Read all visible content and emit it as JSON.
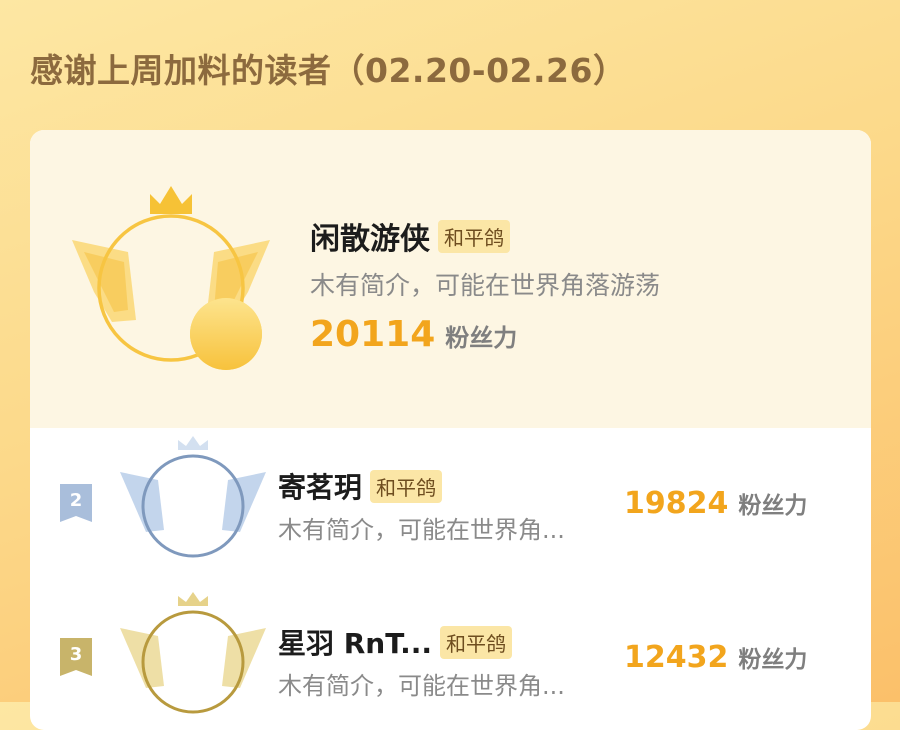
{
  "page": {
    "title": "感谢上周加料的读者（02.20-02.26）"
  },
  "top_reader": {
    "name": "闲散游侠",
    "tag": "和平鸽",
    "bio": "木有简介，可能在世界角落游荡",
    "score": "20114",
    "score_label": "粉丝力"
  },
  "readers": [
    {
      "rank": "2",
      "name": "寄茗玥",
      "tag": "和平鸽",
      "bio": "木有简介，可能在世界角...",
      "score": "19824",
      "score_label": "粉丝力"
    },
    {
      "rank": "3",
      "name": "星羽  RnT...",
      "tag": "和平鸽",
      "bio": "木有简介，可能在世界角...",
      "score": "12432",
      "score_label": "粉丝力"
    }
  ],
  "colors": {
    "gold": "#f7c542",
    "silver": "#7f99bd",
    "bronze": "#b89a3e",
    "score": "#f2a51d"
  }
}
